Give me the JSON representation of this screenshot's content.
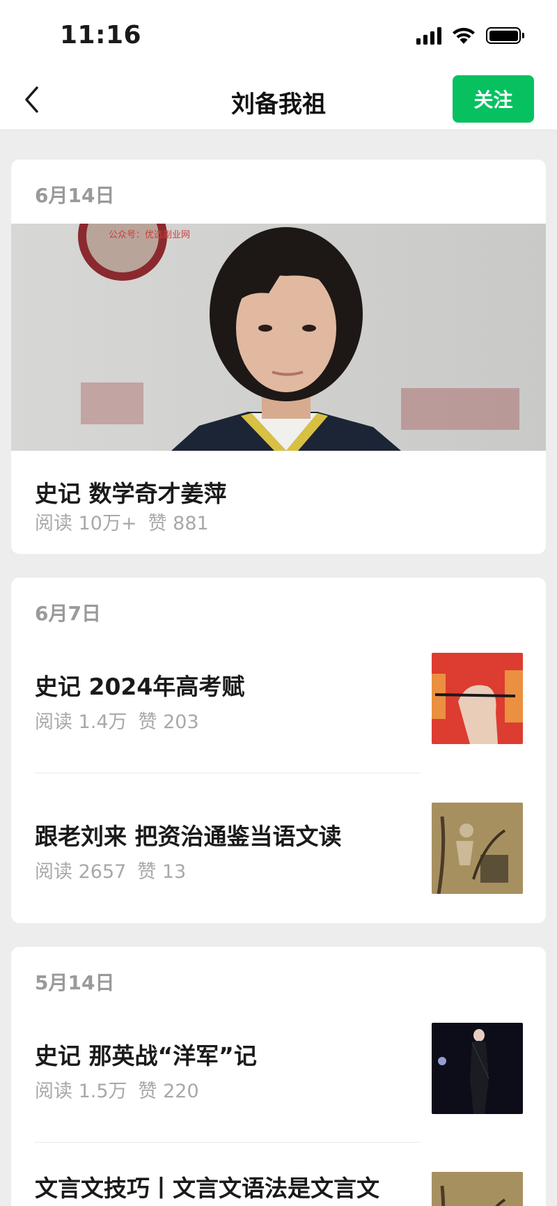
{
  "status_bar": {
    "time": "11:16",
    "icons": [
      "signal-icon",
      "wifi-icon",
      "battery-icon"
    ]
  },
  "nav": {
    "back_icon": "chevron-left-icon",
    "title": "刘备我祖",
    "follow_label": "关注"
  },
  "colors": {
    "accent": "#07c160",
    "background": "#ededed",
    "meta_text": "#a8a8a8"
  },
  "groups": [
    {
      "date": "6月14日",
      "articles": [
        {
          "title": "史记  数学奇才姜萍",
          "reads": "阅读 10万+",
          "likes": "赞 881",
          "image": "hero-photo",
          "watermark": "公众号：优选副业网"
        }
      ]
    },
    {
      "date": "6月7日",
      "articles": [
        {
          "title": "史记  2024年高考赋",
          "reads": "阅读 1.4万",
          "likes": "赞 203",
          "image": "gaokao-thumbnail"
        },
        {
          "title": "跟老刘来  把资治通鉴当语文读",
          "reads": "阅读 2657",
          "likes": "赞 13",
          "image": "painting-thumbnail"
        }
      ]
    },
    {
      "date": "5月14日",
      "articles": [
        {
          "title": "史记  那英战“洋军”记",
          "reads": "阅读 1.5万",
          "likes": "赞 220",
          "image": "stage-thumbnail"
        },
        {
          "title": "文言文技巧丨文言文语法是文言文",
          "image": "painting-thumbnail"
        }
      ]
    }
  ]
}
